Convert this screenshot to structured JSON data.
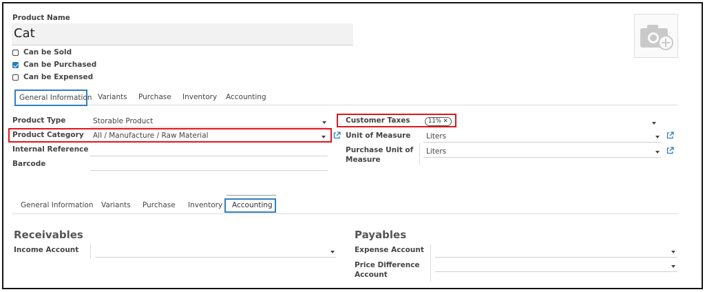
{
  "product": {
    "name_label": "Product Name",
    "name_value": "Cat",
    "checkboxes": [
      {
        "label": "Can be Sold",
        "checked": false
      },
      {
        "label": "Can be Purchased",
        "checked": true
      },
      {
        "label": "Can be Expensed",
        "checked": false
      }
    ],
    "photo_icon": "camera-plus-icon"
  },
  "tabs_top": [
    "General Information",
    "Variants",
    "Purchase",
    "Inventory",
    "Accounting"
  ],
  "general": {
    "product_type_label": "Product Type",
    "product_type_value": "Storable Product",
    "product_category_label": "Product Category",
    "product_category_value": "All / Manufacture / Raw Material",
    "internal_reference_label": "Internal Reference",
    "barcode_label": "Barcode",
    "customer_taxes_label": "Customer Taxes",
    "customer_taxes_tag": "11%",
    "uom_label": "Unit of Measure",
    "uom_value": "Liters",
    "purchase_uom_label_1": "Purchase Unit of",
    "purchase_uom_label_2": "Measure",
    "purchase_uom_value": "Liters"
  },
  "tabs_bottom": [
    "General Information",
    "Variants",
    "Purchase",
    "Inventory",
    "Accounting"
  ],
  "accounting": {
    "receivables_title": "Receivables",
    "income_account_label": "Income Account",
    "payables_title": "Payables",
    "expense_account_label": "Expense Account",
    "price_difference_label_1": "Price Difference",
    "price_difference_label_2": "Account"
  },
  "colors": {
    "highlight_red": "#e1141b",
    "highlight_blue": "#2e7ec3",
    "checkbox_blue": "#2b7bb9"
  }
}
